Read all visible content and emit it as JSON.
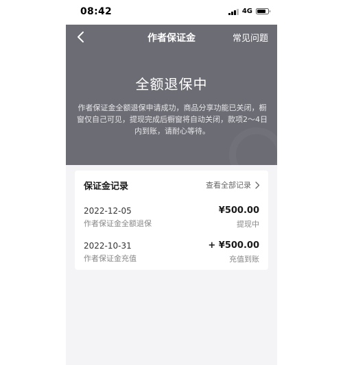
{
  "status_bar": {
    "time": "08:42",
    "network": "4G"
  },
  "nav": {
    "title": "作者保证金",
    "faq": "常见问题",
    "back_icon": "chevron-left-icon"
  },
  "header": {
    "status": "全额退保中",
    "description": "作者保证金全额退保申请成功，商品分享功能已关闭，橱窗仅自己可见，提现完成后橱窗将自动关闭，款项2～4日内到账，请耐心等待。"
  },
  "records": {
    "title": "保证金记录",
    "view_all": "查看全部记录",
    "items": [
      {
        "date": "2022-12-05",
        "type": "作者保证金全额退保",
        "amount": "¥500.00",
        "status": "提现中"
      },
      {
        "date": "2022-10-31",
        "type": "作者保证金充值",
        "amount": "+ ¥500.00",
        "status": "充值到账"
      }
    ]
  },
  "colors": {
    "header_bg": "#6c6c74",
    "body_bg": "#f4f4f6",
    "card_bg": "#ffffff"
  }
}
